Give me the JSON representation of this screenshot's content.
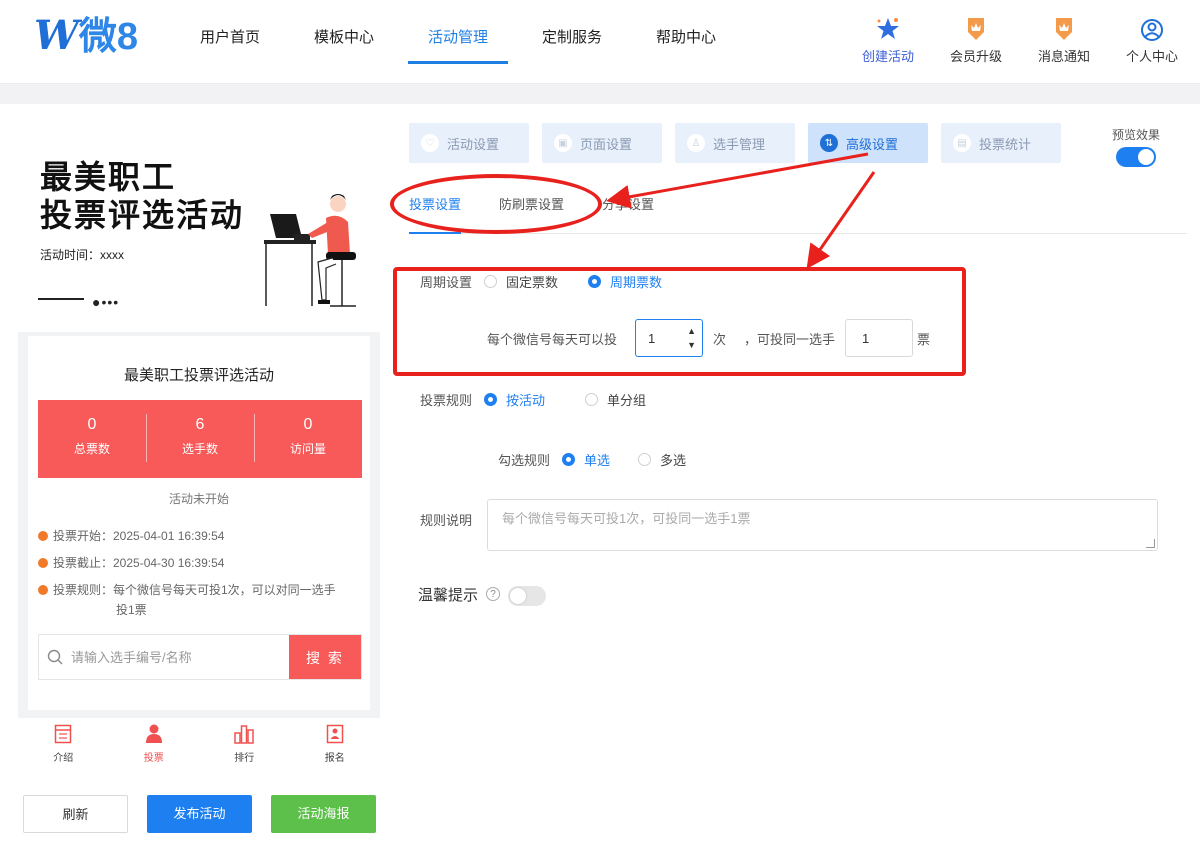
{
  "logo": {
    "w": "W",
    "text": "微8"
  },
  "nav": [
    {
      "label": "用户首页",
      "active": false
    },
    {
      "label": "模板中心",
      "active": false
    },
    {
      "label": "活动管理",
      "active": true
    },
    {
      "label": "定制服务",
      "active": false
    },
    {
      "label": "帮助中心",
      "active": false
    }
  ],
  "top_actions": {
    "create": "创建活动",
    "upgrade": "会员升级",
    "notify": "消息通知",
    "profile": "个人中心"
  },
  "phone": {
    "banner_title_1": "最美职工",
    "banner_title_2": "投票评选活动",
    "banner_time": "活动时间：xxxx",
    "card_title": "最美职工投票评选活动",
    "stats": [
      {
        "value": "0",
        "label": "总票数"
      },
      {
        "value": "6",
        "label": "选手数"
      },
      {
        "value": "0",
        "label": "访问量"
      }
    ],
    "status": "活动未开始",
    "vote_start": "投票开始：2025-04-01 16:39:54",
    "vote_end": "投票截止：2025-04-30 16:39:54",
    "vote_rule_1": "投票规则：每个微信号每天可投1次，可以对同一选手",
    "vote_rule_2": "投1票",
    "search_placeholder": "请输入选手编号/名称",
    "search_button": "搜 索",
    "tabs": [
      {
        "label": "介绍",
        "active": false
      },
      {
        "label": "投票",
        "active": true
      },
      {
        "label": "排行",
        "active": false
      },
      {
        "label": "报名",
        "active": false
      }
    ]
  },
  "buttons": {
    "refresh": "刷新",
    "publish": "发布活动",
    "poster": "活动海报"
  },
  "steps": [
    {
      "label": "活动设置",
      "active": false
    },
    {
      "label": "页面设置",
      "active": false
    },
    {
      "label": "选手管理",
      "active": false
    },
    {
      "label": "高级设置",
      "active": true
    },
    {
      "label": "投票统计",
      "active": false
    }
  ],
  "preview": {
    "label": "预览效果",
    "on": true
  },
  "subtabs": [
    {
      "label": "投票设置",
      "active": true
    },
    {
      "label": "防刷票设置",
      "active": false
    },
    {
      "label": "分享设置",
      "active": false
    }
  ],
  "form": {
    "cycle_label": "周期设置",
    "cycle_fixed": "固定票数",
    "cycle_periodic": "周期票数",
    "per_day_text": "每个微信号每天可以投",
    "per_day_value": "1",
    "times_unit": "次",
    "same_player_text": "，可投同一选手",
    "same_player_value": "1",
    "votes_unit": "票",
    "rule_label": "投票规则",
    "rule_by_activity": "按活动",
    "rule_by_group": "单分组",
    "select_label": "勾选规则",
    "select_single": "单选",
    "select_multi": "多选",
    "desc_label": "规则说明",
    "desc_placeholder": "每个微信号每天可投1次，可投同一选手1票",
    "tips_label": "温馨提示",
    "tips_on": false
  },
  "colors": {
    "primary": "#1e80f0",
    "danger": "#f85a5a",
    "success": "#5cc04a",
    "annotation": "#e8211c"
  }
}
